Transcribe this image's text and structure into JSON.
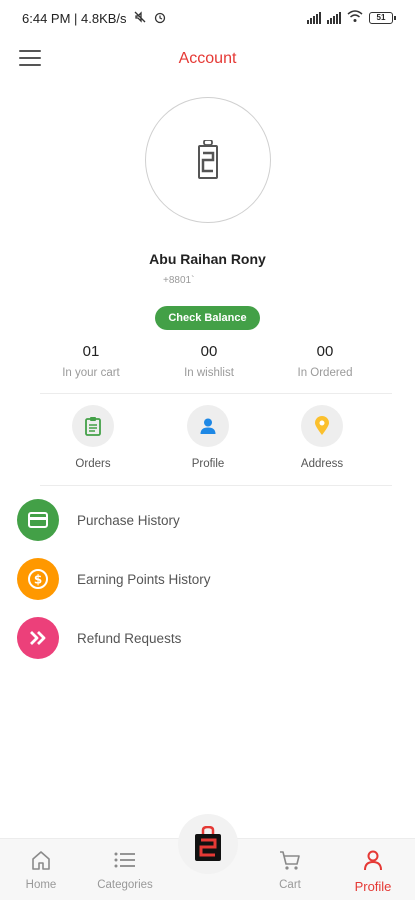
{
  "status_bar": {
    "time_speed": "6:44 PM | 4.8KB/s",
    "battery": "51"
  },
  "header": {
    "title": "Account"
  },
  "profile": {
    "name": "Abu Raihan Rony",
    "phone": "+8801`",
    "check_balance_label": "Check Balance"
  },
  "stats": [
    {
      "value": "01",
      "label": "In your cart"
    },
    {
      "value": "00",
      "label": "In wishlist"
    },
    {
      "value": "00",
      "label": "In Ordered"
    }
  ],
  "quick_links": [
    {
      "label": "Orders",
      "icon": "clipboard-icon"
    },
    {
      "label": "Profile",
      "icon": "person-icon"
    },
    {
      "label": "Address",
      "icon": "location-pin-icon"
    }
  ],
  "menu": [
    {
      "label": "Purchase History",
      "icon": "card-icon",
      "color": "#43a047"
    },
    {
      "label": "Earning Points History",
      "icon": "dollar-coin-icon",
      "color": "#ff9800"
    },
    {
      "label": "Refund Requests",
      "icon": "double-chevron-icon",
      "color": "#ec407a"
    }
  ],
  "bottom_nav": [
    {
      "label": "Home",
      "icon": "home-icon"
    },
    {
      "label": "Categories",
      "icon": "list-icon"
    },
    {
      "label": "Cart",
      "icon": "cart-icon"
    },
    {
      "label": "Profile",
      "icon": "user-icon",
      "active": true
    }
  ],
  "colors": {
    "accent": "#e53935",
    "green": "#43a047",
    "orange": "#ff9800",
    "pink": "#ec407a",
    "icon_blue": "#1e88e5",
    "icon_yellow": "#fbc02d"
  }
}
